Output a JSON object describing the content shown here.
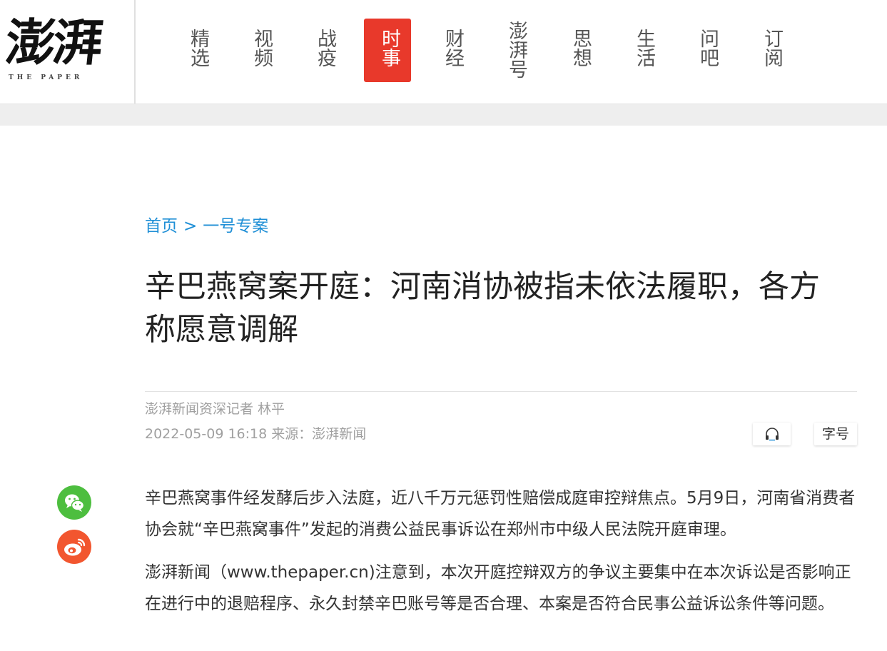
{
  "header": {
    "logo_cn": "澎湃",
    "logo_en": "THE PAPER",
    "nav": [
      {
        "label": "精选",
        "active": false
      },
      {
        "label": "视频",
        "active": false
      },
      {
        "label": "战疫",
        "active": false
      },
      {
        "label": "时事",
        "active": true
      },
      {
        "label": "财经",
        "active": false
      },
      {
        "label": "澎湃号",
        "active": false
      },
      {
        "label": "思想",
        "active": false
      },
      {
        "label": "生活",
        "active": false
      },
      {
        "label": "问吧",
        "active": false
      },
      {
        "label": "订阅",
        "active": false
      }
    ]
  },
  "breadcrumb": {
    "home": "首页",
    "separator": ">",
    "section": "一号专案"
  },
  "article": {
    "title": "辛巴燕窝案开庭：河南消协被指未依法履职，各方称愿意调解",
    "byline": "澎湃新闻资深记者 林平",
    "dateline": "2022-05-09 16:18 来源：澎湃新闻",
    "font_size_label": "字号",
    "paragraphs": [
      "辛巴燕窝事件经发酵后步入法庭，近八千万元惩罚性赔偿成庭审控辩焦点。5月9日，河南省消费者协会就“辛巴燕窝事件”发起的消费公益民事诉讼在郑州市中级人民法院开庭审理。",
      "澎湃新闻（www.thepaper.cn)注意到，本次开庭控辩双方的争议主要集中在本次诉讼是否影响正在进行中的退赔程序、永久封禁辛巴账号等是否合理、本案是否符合民事公益诉讼条件等问题。"
    ]
  },
  "share": {
    "icons": [
      "wechat-icon",
      "weibo-icon"
    ]
  },
  "colors": {
    "accent": "#e8392b",
    "link": "#1f8fd6",
    "wechat": "#4dbe3f",
    "weibo": "#f2562f"
  }
}
